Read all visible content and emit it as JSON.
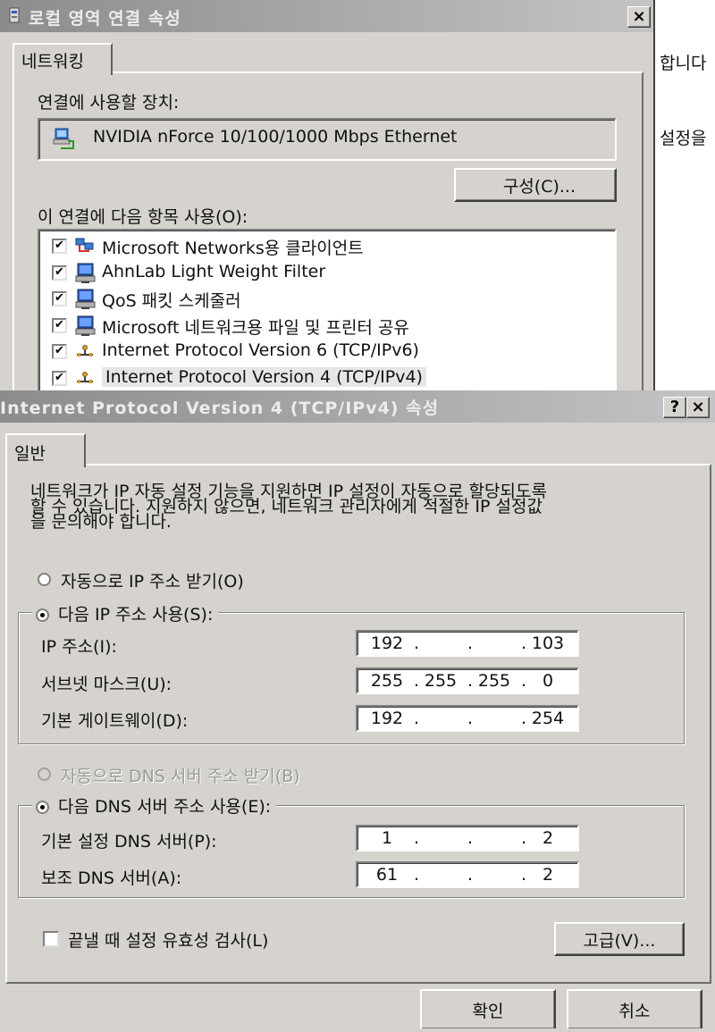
{
  "bg_right": {
    "line1": "합니다",
    "line2": "설정을"
  },
  "lan": {
    "title": "로컬 영역 연결 속성",
    "close": "×",
    "tab": "네트워킹",
    "device_label": "연결에 사용할 장치:",
    "device_name": "NVIDIA nForce 10/100/1000 Mbps Ethernet",
    "configure_button": "구성(C)...",
    "items_label": "이 연결에 다음 항목 사용(O):",
    "items": [
      {
        "label": "Microsoft Networks용 클라이언트",
        "icon": "network-client-icon",
        "checked": true
      },
      {
        "label": "AhnLab Light Weight Filter",
        "icon": "computer-icon",
        "checked": true
      },
      {
        "label": "QoS 패킷 스케줄러",
        "icon": "computer-icon",
        "checked": true
      },
      {
        "label": "Microsoft 네트워크용 파일 및 프린터 공유",
        "icon": "computer-icon",
        "checked": true
      },
      {
        "label": "Internet Protocol Version 6 (TCP/IPv6)",
        "icon": "protocol-icon",
        "checked": true
      },
      {
        "label": "Internet Protocol Version 4 (TCP/IPv4)",
        "icon": "protocol-icon",
        "checked": true
      }
    ]
  },
  "ipv4": {
    "title": "Internet Protocol Version 4 (TCP/IPv4) 속성",
    "help": "?",
    "close": "×",
    "tab": "일반",
    "desc_line1": "네트워크가 IP 자동 설정 기능을 지원하면 IP 설정이 자동으로 할당되도록",
    "desc_line2": "할 수 있습니다. 지원하지 않으면, 네트워크 관리자에게 적절한 IP 설정값",
    "desc_line3": "을 문의해야 합니다.",
    "auto_ip": "자동으로 IP 주소 받기(O)",
    "manual_ip": "다음 IP 주소 사용(S):",
    "ip_label": "IP 주소(I):",
    "ip": [
      "192",
      "",
      "",
      "103"
    ],
    "mask_label": "서브넷 마스크(U):",
    "mask": [
      "255",
      "255",
      "255",
      "0"
    ],
    "gw_label": "기본 게이트웨이(D):",
    "gw": [
      "192",
      "",
      "",
      "254"
    ],
    "auto_dns": "자동으로 DNS 서버 주소 받기(B)",
    "manual_dns": "다음 DNS 서버 주소 사용(E):",
    "dns1_label": "기본 설정 DNS 서버(P):",
    "dns1": [
      "1",
      "",
      "",
      "2"
    ],
    "dns2_label": "보조 DNS 서버(A):",
    "dns2": [
      "61",
      "",
      "",
      "2"
    ],
    "validate": "끝낼 때 설정 유효성 검사(L)",
    "advanced": "고급(V)...",
    "ok": "확인",
    "cancel": "취소",
    "check_mark": "✔",
    "ip_dot": "."
  },
  "colors": {
    "title_gradient_start": "#8c8c8c",
    "title_gradient_end": "#c4c4c4",
    "dialog_face": "#d6d3ce"
  }
}
